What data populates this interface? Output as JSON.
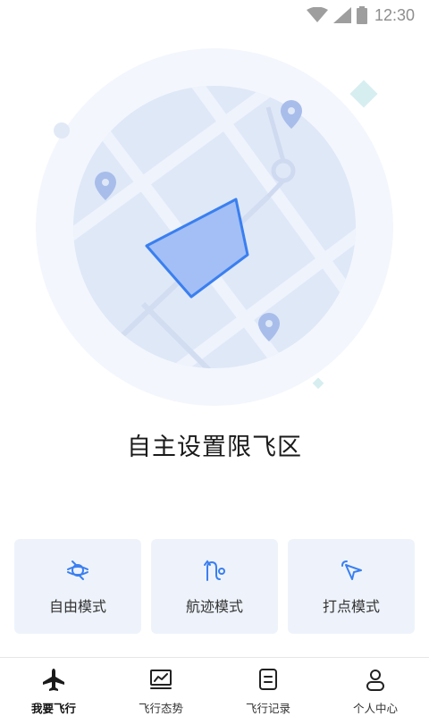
{
  "status_bar": {
    "time": "12:30",
    "icons": [
      "wifi-icon",
      "signal-icon",
      "battery-icon"
    ]
  },
  "hero": {
    "title": "自主设置限飞区",
    "illustration": "map-with-polygon-zone"
  },
  "modes": [
    {
      "label": "自由模式",
      "icon": "free-mode-icon"
    },
    {
      "label": "航迹模式",
      "icon": "track-mode-icon"
    },
    {
      "label": "打点模式",
      "icon": "point-mode-icon"
    }
  ],
  "tabbar": {
    "active": "我要飞行",
    "tabs": [
      {
        "label": "我要飞行",
        "icon": "airplane-icon"
      },
      {
        "label": "飞行态势",
        "icon": "trend-chart-icon"
      },
      {
        "label": "飞行记录",
        "icon": "record-icon"
      },
      {
        "label": "个人中心",
        "icon": "user-icon"
      }
    ]
  },
  "colors": {
    "accent": "#3a7ff0",
    "card_bg": "#eef3fb",
    "map_bg": "#dfe8f7"
  }
}
